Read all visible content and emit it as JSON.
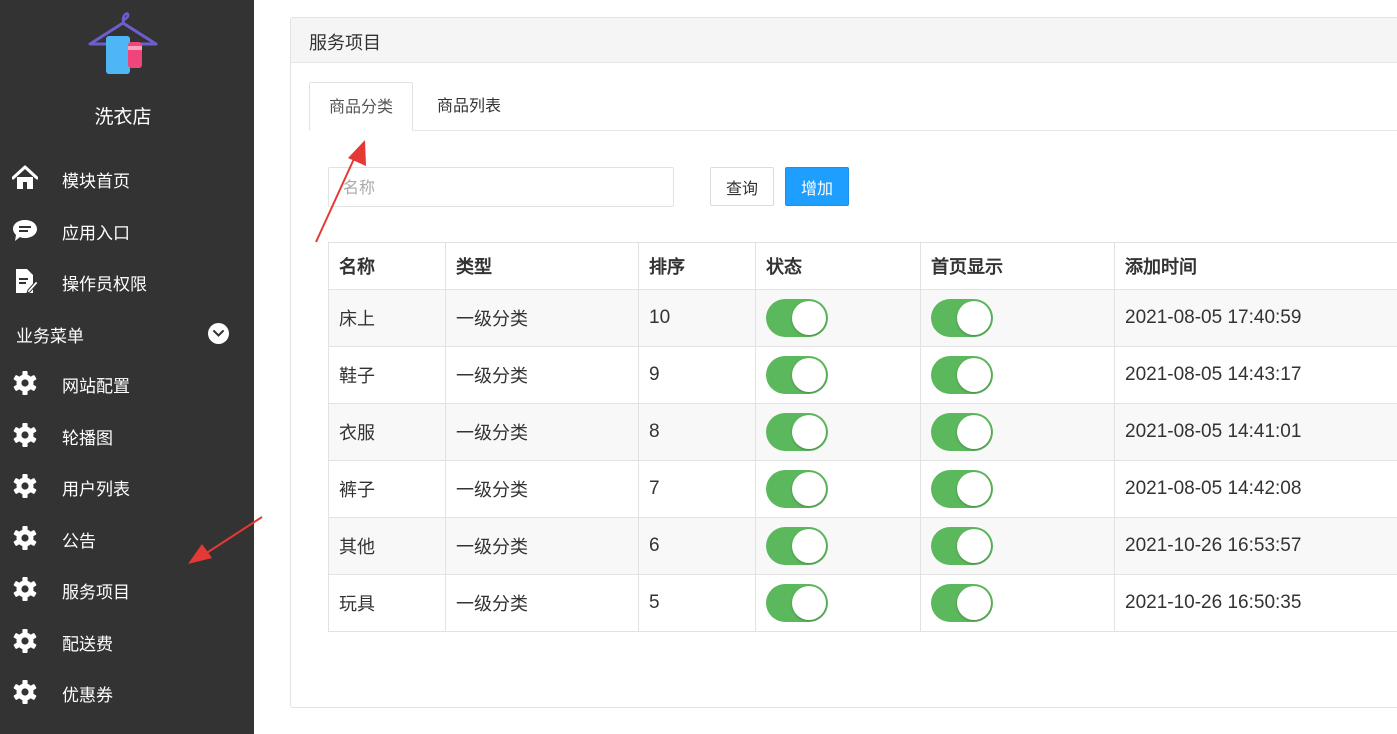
{
  "app": {
    "name": "洗衣店",
    "logo_icon": "hanger-shirt-logo-icon"
  },
  "sidebar": {
    "items": [
      {
        "label": "模块首页",
        "icon": "home-icon"
      },
      {
        "label": "应用入口",
        "icon": "chat-bubble-icon"
      },
      {
        "label": "操作员权限",
        "icon": "document-edit-icon"
      }
    ],
    "group": {
      "label": "业务菜单",
      "toggle_icon": "chevron-down-icon"
    },
    "group_items": [
      {
        "label": "网站配置",
        "icon": "gear-icon"
      },
      {
        "label": "轮播图",
        "icon": "gear-icon"
      },
      {
        "label": "用户列表",
        "icon": "gear-icon"
      },
      {
        "label": "公告",
        "icon": "gear-icon"
      },
      {
        "label": "服务项目",
        "icon": "gear-icon"
      },
      {
        "label": "配送费",
        "icon": "gear-icon"
      },
      {
        "label": "优惠券",
        "icon": "gear-icon"
      }
    ]
  },
  "panel": {
    "title": "服务项目",
    "tabs": [
      {
        "label": "商品分类",
        "active": true
      },
      {
        "label": "商品列表",
        "active": false
      }
    ]
  },
  "search": {
    "placeholder": "名称",
    "value": "",
    "query_label": "查询",
    "add_label": "增加"
  },
  "table": {
    "columns": [
      "名称",
      "类型",
      "排序",
      "状态",
      "首页显示",
      "添加时间"
    ],
    "rows": [
      {
        "name": "床上",
        "type": "一级分类",
        "sort": "10",
        "status": true,
        "home": true,
        "time": "2021-08-05 17:40:59"
      },
      {
        "name": "鞋子",
        "type": "一级分类",
        "sort": "9",
        "status": true,
        "home": true,
        "time": "2021-08-05 14:43:17"
      },
      {
        "name": "衣服",
        "type": "一级分类",
        "sort": "8",
        "status": true,
        "home": true,
        "time": "2021-08-05 14:41:01"
      },
      {
        "name": "裤子",
        "type": "一级分类",
        "sort": "7",
        "status": true,
        "home": true,
        "time": "2021-08-05 14:42:08"
      },
      {
        "name": "其他",
        "type": "一级分类",
        "sort": "6",
        "status": true,
        "home": true,
        "time": "2021-10-26 16:53:57"
      },
      {
        "name": "玩具",
        "type": "一级分类",
        "sort": "5",
        "status": true,
        "home": true,
        "time": "2021-10-26 16:50:35"
      }
    ]
  },
  "colors": {
    "sidebar_bg": "#333333",
    "accent": "#1e9fff",
    "switch_on": "#5cb85c",
    "annotation_arrow": "#e53935"
  }
}
